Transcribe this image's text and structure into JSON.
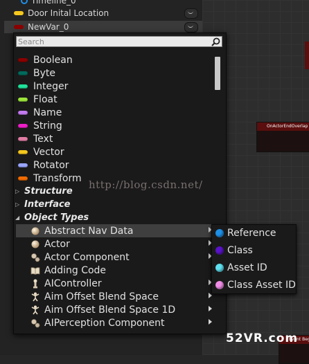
{
  "colors": {
    "boolean": "#8c0000",
    "byte": "#006b5c",
    "integer": "#1fe29a",
    "float": "#9ce63a",
    "name": "#c37af0",
    "string": "#f01ec8",
    "text": "#e07ca4",
    "vector": "#f5c81e",
    "rotator": "#9aa6ff",
    "transform": "#f06a00",
    "reference": "#1e90e8",
    "class": "#5a12c8",
    "asset_id": "#5fe0f0",
    "class_asset_id": "#f08ce6",
    "door_pill": "#f5c81e",
    "newvar_pill": "#8c0000",
    "node_title": "#5a0e0e",
    "timeline_icon": "#1e90e8"
  },
  "variables_panel": {
    "timeline_label": "Timeline_0",
    "door_label": "Door Inital Location",
    "newvar_label": "NewVar_0"
  },
  "search": {
    "placeholder": "Search",
    "value": ""
  },
  "type_menu": {
    "basic_types": [
      {
        "label": "Boolean",
        "icon": "boolean-pill-icon"
      },
      {
        "label": "Byte",
        "icon": "byte-pill-icon"
      },
      {
        "label": "Integer",
        "icon": "integer-pill-icon"
      },
      {
        "label": "Float",
        "icon": "float-pill-icon"
      },
      {
        "label": "Name",
        "icon": "name-pill-icon"
      },
      {
        "label": "String",
        "icon": "string-pill-icon"
      },
      {
        "label": "Text",
        "icon": "text-pill-icon"
      },
      {
        "label": "Vector",
        "icon": "vector-pill-icon"
      },
      {
        "label": "Rotator",
        "icon": "rotator-pill-icon"
      },
      {
        "label": "Transform",
        "icon": "transform-pill-icon"
      }
    ],
    "categories": [
      {
        "label": "Structure",
        "expanded": false
      },
      {
        "label": "Interface",
        "expanded": false
      },
      {
        "label": "Object Types",
        "expanded": true
      }
    ],
    "object_types": [
      {
        "label": "Abstract Nav Data",
        "icon": "sphere-icon",
        "selected": true
      },
      {
        "label": "Actor",
        "icon": "sphere-icon",
        "selected": false
      },
      {
        "label": "Actor Component",
        "icon": "gears-icon",
        "selected": false
      },
      {
        "label": "Adding Code",
        "icon": "book-icon",
        "selected": false
      },
      {
        "label": "AIController",
        "icon": "pawn-icon",
        "selected": false
      },
      {
        "label": "Aim Offset Blend Space",
        "icon": "blendspace-icon",
        "selected": false
      },
      {
        "label": "Aim Offset Blend Space 1D",
        "icon": "blendspace-1d-icon",
        "selected": false
      },
      {
        "label": "AIPerception Component",
        "icon": "gears-icon",
        "selected": false
      }
    ]
  },
  "container_menu": {
    "items": [
      {
        "label": "Reference",
        "icon": "reference-dot-icon"
      },
      {
        "label": "Class",
        "icon": "class-dot-icon"
      },
      {
        "label": "Asset ID",
        "icon": "asset-id-dot-icon"
      },
      {
        "label": "Class Asset ID",
        "icon": "class-asset-id-dot-icon"
      }
    ]
  },
  "graph": {
    "node1_title": "OnActorEndOverlap (Sk",
    "node2_title": "Event Begin"
  },
  "watermarks": {
    "url": "http://blog.csdn.net/",
    "brand": "52VR.com"
  }
}
